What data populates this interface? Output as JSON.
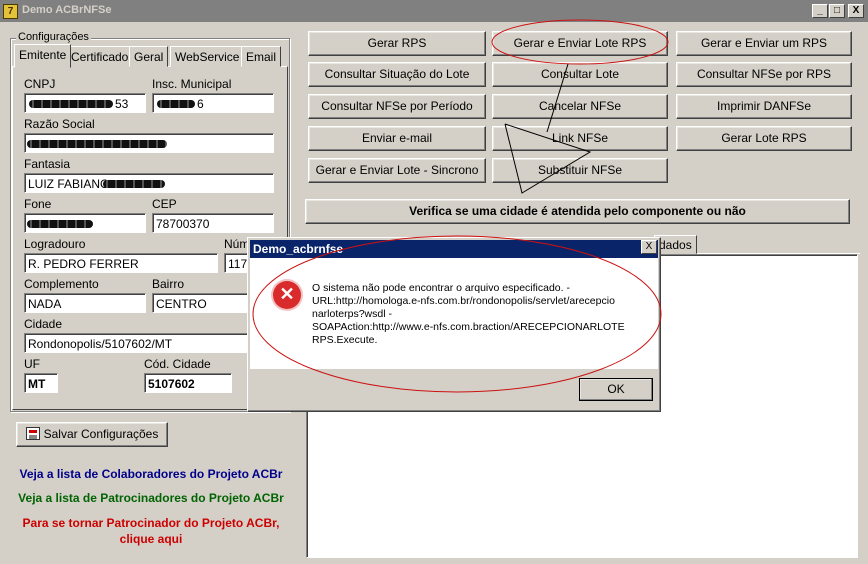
{
  "window": {
    "title": "Demo ACBrNFSe",
    "icon_label": "7"
  },
  "title_buttons": {
    "minimize": "_",
    "maximize": "□",
    "close": "X"
  },
  "config_group": {
    "legend": "Configurações",
    "tabs": [
      "Emitente",
      "Certificado",
      "Geral",
      "WebService",
      "Email"
    ],
    "active_tab": "Emitente",
    "labels": {
      "cnpj": "CNPJ",
      "insc_municipal": "Insc. Municipal",
      "razao_social": "Razão Social",
      "fantasia": "Fantasia",
      "fone": "Fone",
      "cep": "CEP",
      "logradouro": "Logradouro",
      "numero": "Núm",
      "complemento": "Complemento",
      "bairro": "Bairro",
      "cidade": "Cidade",
      "uf": "UF",
      "cod_cidade": "Cód. Cidade"
    },
    "values": {
      "cnpj_tail": "53",
      "insc_tail": "6",
      "fantasia_partial": "LUIZ FABIANO",
      "cep": "78700370",
      "logradouro": "R. PEDRO FERRER",
      "numero": "117",
      "complemento": "NADA",
      "bairro": "CENTRO",
      "cidade": "Rondonopolis/5107602/MT",
      "uf": "MT",
      "cod_cidade": "5107602"
    }
  },
  "save_button": {
    "label": "Salvar Configurações",
    "icon": "save-config-icon"
  },
  "links": {
    "colaboradores": "Veja a lista de Colaboradores do Projeto ACBr",
    "patrocinadores": "Veja a lista de Patrocinadores do Projeto ACBr",
    "patrocinador_line1": "Para se tornar Patrocinador do Projeto ACBr,",
    "patrocinador_line2": "clique aqui"
  },
  "actions": {
    "gerar_rps": "Gerar RPS",
    "gerar_enviar_lote": "Gerar e Enviar Lote RPS",
    "gerar_enviar_um": "Gerar e Enviar um RPS",
    "consultar_situacao": "Consultar Situação do Lote",
    "consultar_lote": "Consultar Lote",
    "consultar_nfse_rps": "Consultar NFSe por RPS",
    "consultar_nfse_periodo": "Consultar NFSe por Período",
    "cancelar_nfse": "Cancelar NFSe",
    "imprimir_danfse": "Imprimir DANFSe",
    "enviar_email": "Enviar e-mail",
    "link_nfse": "Link NFSe",
    "gerar_lote_rps": "Gerar Lote RPS",
    "gerar_enviar_sincrono": "Gerar e Enviar Lote - Sincrono",
    "substituir_nfse": "Substituir NFSe",
    "verifica_cidade": "Verifica se uma cidade é atendida pelo componente ou não"
  },
  "result_tabs": {
    "visible_suffix": "dados"
  },
  "dialog": {
    "title": "Demo_acbrnfse",
    "close": "X",
    "icon": "error-icon",
    "message": "O sistema não pode encontrar o arquivo especificado. -\nURL:http://homologa.e-nfs.com.br/rondonopolis/servlet/arecepcio\nnarloterps?wsdl -\nSOAPAction:http://www.e-nfs.com.braction/ARECEPCIONARLOTE\nRPS.Execute.",
    "ok": "OK"
  },
  "colors": {
    "annotation": "#cc1111",
    "link_blue": "#00008b",
    "link_green": "#006400",
    "link_red": "#cc0000",
    "dialog_title": "#0a246a"
  }
}
